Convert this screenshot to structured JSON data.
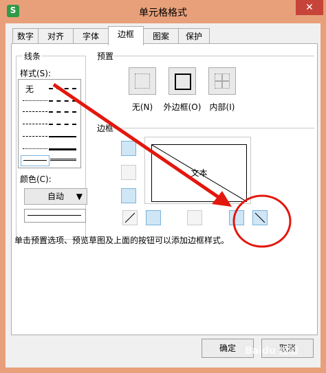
{
  "window": {
    "title": "单元格格式",
    "app_icon_letter": "S",
    "close_glyph": "✕"
  },
  "tabs": [
    {
      "label": "数字"
    },
    {
      "label": "对齐"
    },
    {
      "label": "字体"
    },
    {
      "label": "边框",
      "active": true
    },
    {
      "label": "图案"
    },
    {
      "label": "保护"
    }
  ],
  "line_group": {
    "title": "线条",
    "style_label": "样式(S):",
    "none_label": "无",
    "color_label": "颜色(C):",
    "color_value": "自动"
  },
  "presets": {
    "title": "预置",
    "items": [
      {
        "label": "无(N)",
        "icon": "no-border-icon"
      },
      {
        "label": "外边框(O)",
        "icon": "outline-border-icon"
      },
      {
        "label": "内部(I)",
        "icon": "inside-border-icon"
      }
    ]
  },
  "border": {
    "title": "边框",
    "preview_text": "文本"
  },
  "hint": "单击预置选项、预览草图及上面的按钮可以添加边框样式。",
  "buttons": {
    "ok": "确定",
    "cancel": "取消"
  },
  "watermark": "Baidu 经验",
  "colors": {
    "arrow": "#e3170d",
    "active_button": "#cfe6f7",
    "titlebar": "#e8a07a"
  }
}
